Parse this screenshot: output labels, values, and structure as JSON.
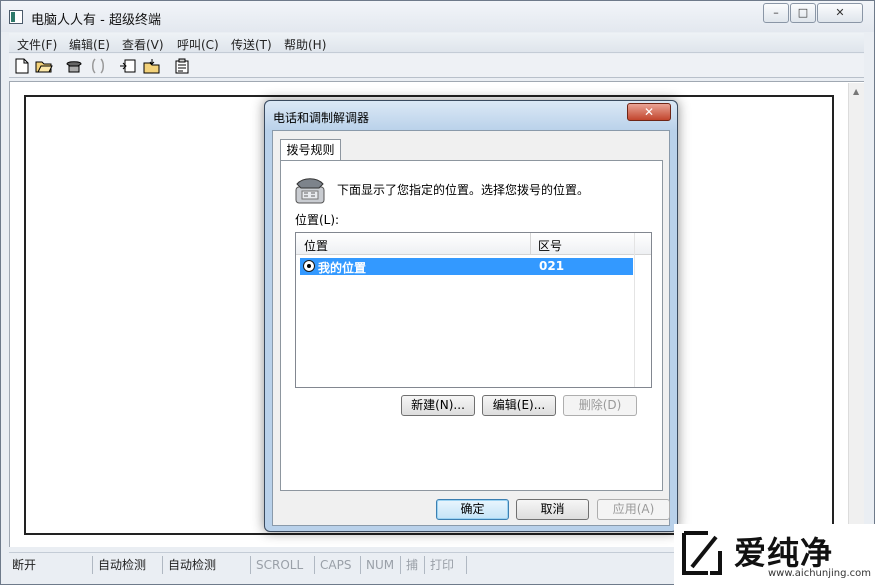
{
  "app": {
    "title": "电脑人人有 - 超级终端",
    "window_controls": {
      "minimize": "–",
      "maximize": "□",
      "close": "✕"
    }
  },
  "menu": [
    "文件(F)",
    "编辑(E)",
    "查看(V)",
    "呼叫(C)",
    "传送(T)",
    "帮助(H)"
  ],
  "toolbar": {
    "icons": [
      "new-file-icon",
      "open-folder-icon",
      "phone-icon",
      "disconnect-icon",
      "send-icon",
      "receive-icon",
      "properties-icon"
    ]
  },
  "statusbar": {
    "cells": [
      "断开",
      "自动检测",
      "自动检测",
      "SCROLL",
      "CAPS",
      "NUM",
      "捕",
      "打印"
    ]
  },
  "dialog": {
    "title": "电话和调制解调器",
    "close": "✕",
    "tab": "拨号规则",
    "description": "下面显示了您指定的位置。选择您拨号的位置。",
    "location_label": "位置(L):",
    "list": {
      "columns": [
        "位置",
        "区号"
      ],
      "rows": [
        {
          "location": "我的位置",
          "area_code": "021",
          "selected": true
        }
      ]
    },
    "buttons": {
      "new": "新建(N)...",
      "edit": "编辑(E)...",
      "delete": "删除(D)",
      "ok": "确定",
      "cancel": "取消",
      "apply": "应用(A)"
    }
  },
  "watermark": {
    "brand": "爱纯净",
    "url": "www.aichunjing.com"
  },
  "colors": {
    "selection": "#3399ff",
    "dialog_frame": "#b9d1ea",
    "close_button": "#c2452d"
  }
}
